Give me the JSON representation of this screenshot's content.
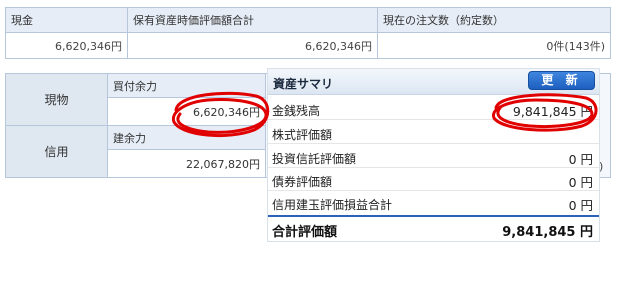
{
  "top_table": {
    "headers": [
      "現金",
      "保有資産時価評価額合計",
      "現在の注文数（約定数）"
    ],
    "values": [
      "6,620,346円",
      "6,620,346円",
      "0件(143件)"
    ]
  },
  "lower_table": {
    "genbutsu_label": "現物",
    "shinyo_label": "信用",
    "kaitsuke_label": "買付余力",
    "kaitsuke_value": "6,620,346円",
    "tate_label": "建余力",
    "tate_value": "22,067,820円",
    "right_partial_value": ")"
  },
  "popup": {
    "title": "資産サマリ",
    "refresh_label": "更 新",
    "rows": [
      {
        "label": "金銭残高",
        "value": "9,841,845 円"
      },
      {
        "label": "株式評価額",
        "value": ""
      },
      {
        "label": "投資信託評価額",
        "value": "0 円"
      },
      {
        "label": "債券評価額",
        "value": "0 円"
      },
      {
        "label": "信用建玉評価損益合計",
        "value": "0 円"
      }
    ],
    "total_label": "合計評価額",
    "total_value": "9,841,845 円"
  },
  "colors": {
    "header_bg": "#e6edf6",
    "border": "#b6c7dc",
    "button": "#2a6fd0",
    "annotation_red": "#e00000"
  }
}
